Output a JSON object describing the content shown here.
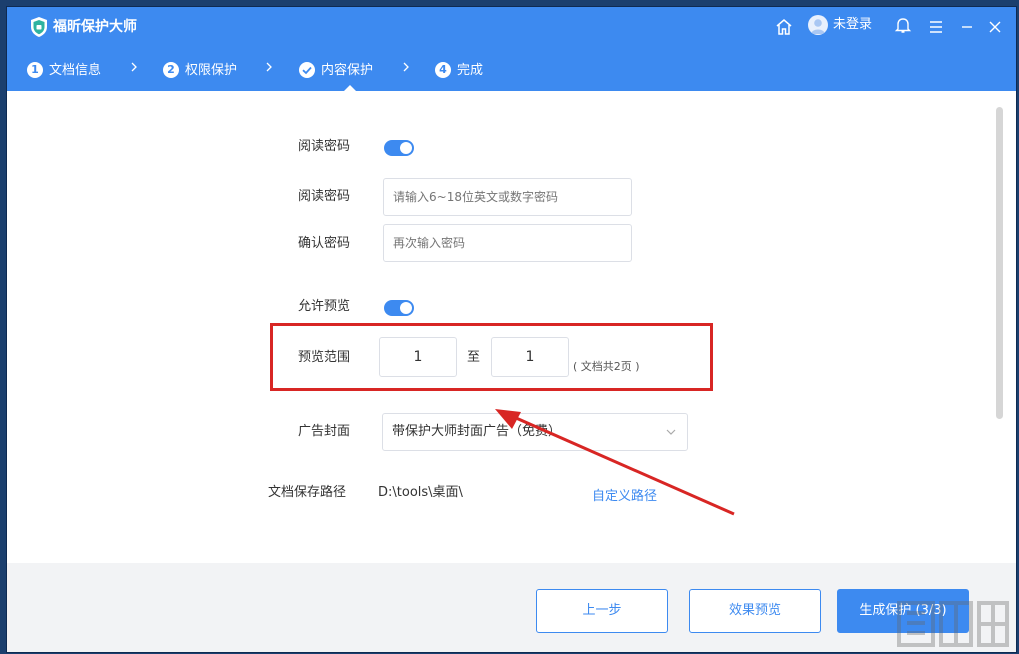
{
  "app": {
    "title": "福昕保护大师"
  },
  "header": {
    "login_label": "未登录"
  },
  "steps": [
    {
      "num": "1",
      "label": "文档信息"
    },
    {
      "num": "2",
      "label": "权限保护"
    },
    {
      "num": "",
      "label": "内容保护"
    },
    {
      "num": "4",
      "label": "完成"
    }
  ],
  "form": {
    "read_password_toggle_label": "阅读密码",
    "read_password_label": "阅读密码",
    "read_password_placeholder": "请输入6~18位英文或数字密码",
    "confirm_password_label": "确认密码",
    "confirm_password_placeholder": "再次输入密码",
    "allow_preview_label": "允许预览",
    "preview_range_label": "预览范围",
    "range_from": "1",
    "range_to_label": "至",
    "range_to": "1",
    "range_note": "( 文档共2页 )",
    "ad_cover_label": "广告封面",
    "ad_cover_value": "带保护大师封面广告（免费）",
    "save_path_label": "文档保存路径",
    "save_path_value": "D:\\tools\\桌面\\",
    "custom_path_link": "自定义路径"
  },
  "footer": {
    "prev_label": "上一步",
    "preview_label": "效果预览",
    "generate_label": "生成保护 (3/3)"
  },
  "colors": {
    "accent": "#3d8af0",
    "annotation": "#d82624"
  }
}
